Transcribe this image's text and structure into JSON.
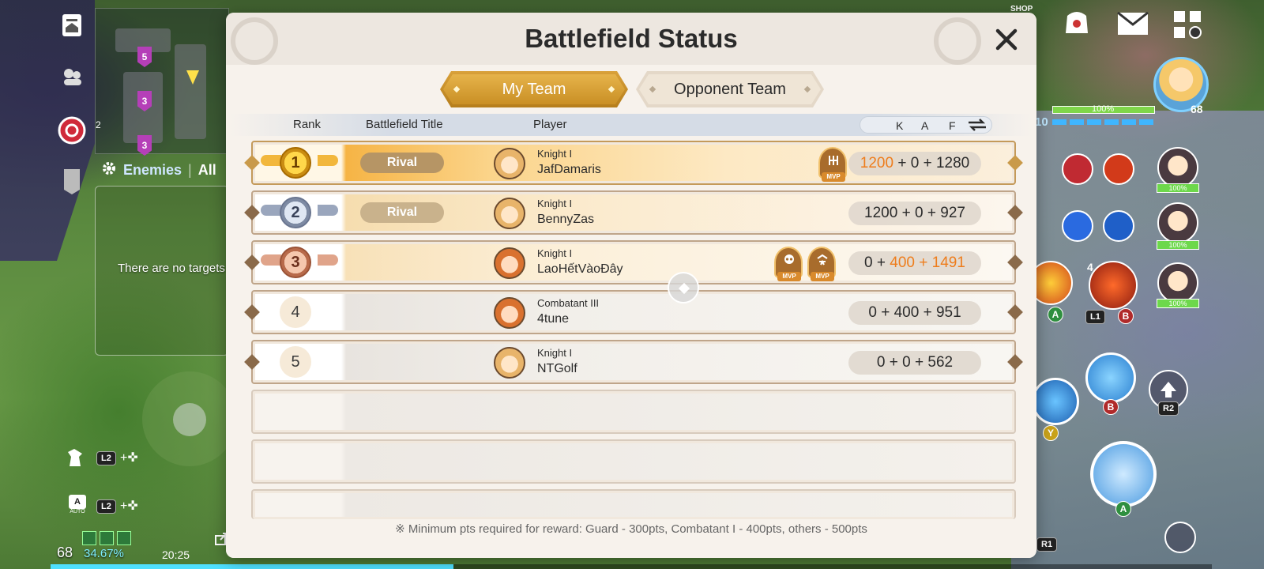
{
  "modal": {
    "title": "Battlefield Status",
    "tabs": [
      {
        "label": "My Team",
        "active": true
      },
      {
        "label": "Opponent Team",
        "active": false
      }
    ],
    "columns": {
      "rank": "Rank",
      "title": "Battlefield Title",
      "player": "Player",
      "k": "K",
      "a": "A",
      "f": "F"
    },
    "rows": [
      {
        "rank": "1",
        "title": "Rival",
        "player_rank": "Knight I",
        "name": "JafDamaris",
        "k": "1200",
        "a": "0",
        "f": "1280",
        "mvp_count": 1
      },
      {
        "rank": "2",
        "title": "Rival",
        "player_rank": "Knight I",
        "name": "BennyZas",
        "k": "1200",
        "a": "0",
        "f": "927",
        "mvp_count": 0
      },
      {
        "rank": "3",
        "title": "",
        "player_rank": "Knight I",
        "name": "LaoHếtVàoĐây",
        "k": "0",
        "a": "400",
        "f": "1491",
        "mvp_count": 2
      },
      {
        "rank": "4",
        "title": "",
        "player_rank": "Combatant III",
        "name": "4tune",
        "k": "0",
        "a": "400",
        "f": "951",
        "mvp_count": 0
      },
      {
        "rank": "5",
        "title": "",
        "player_rank": "Knight I",
        "name": "NTGolf",
        "k": "0",
        "a": "0",
        "f": "562",
        "mvp_count": 0
      }
    ],
    "plus_sign": "+",
    "mvp_label": "MVP",
    "footer": "※ Minimum pts required for reward: Guard - 300pts, Combatant I - 400pts, others - 500pts"
  },
  "left_hud": {
    "enemies_tab": "Enemies",
    "all_tab": "All",
    "no_targets": "There are no targets",
    "minimap_markers": [
      "5",
      "3",
      "3",
      "2"
    ],
    "key_l2": "L2",
    "auto_label": "AUTO",
    "level": "68",
    "xp_percent": "34.67%",
    "clock": "20:25"
  },
  "right_hud": {
    "shop_label": "SHOP",
    "hp_percent": "100%",
    "level": "68",
    "mp_level": "10",
    "ally_hp": [
      "100%",
      "100%",
      "100%"
    ],
    "skill_count": "4",
    "buttons": [
      "A",
      "L1",
      "B",
      "Y",
      "B",
      "R2",
      "A",
      "R1"
    ]
  },
  "colors": {
    "accent_gold": "#d9a13a",
    "highlight_orange": "#ee7d1c",
    "xp_cyan": "#4fe0ff"
  }
}
